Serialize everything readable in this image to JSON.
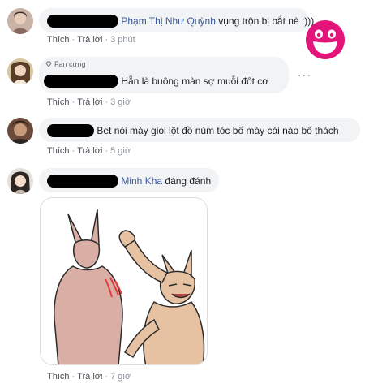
{
  "comments": [
    {
      "name": "Phạm Thị Như Quỳnh",
      "text": "vụng trộn bị bắt nè :)))",
      "actions": {
        "like": "Thích",
        "reply": "Trả lời",
        "time": "3 phút"
      }
    },
    {
      "badge": "Fan cứng",
      "text": "Hẵn là buông màn sợ muỗi đốt cơ",
      "actions": {
        "like": "Thích",
        "reply": "Trả lời",
        "time": "3 giờ"
      }
    },
    {
      "text": "Bet nói mày giỏi lột đồ núm tóc bố mày cái nào bố thách",
      "actions": {
        "like": "Thích",
        "reply": "Trả lời",
        "time": "5 giờ"
      }
    },
    {
      "name": "Minh Kha",
      "text": "đáng đánh",
      "actions": {
        "like": "Thích",
        "reply": "Trả lời",
        "time": "7 giờ"
      }
    }
  ],
  "separator": "·",
  "colors": {
    "name_link": "#385898",
    "bubble": "#f2f3f5",
    "meta": "#90949c",
    "logo_pink": "#e4157a"
  },
  "icons": {
    "badge": "diamond-icon",
    "more": "more-options-icon",
    "logo": "smiley-logo"
  }
}
